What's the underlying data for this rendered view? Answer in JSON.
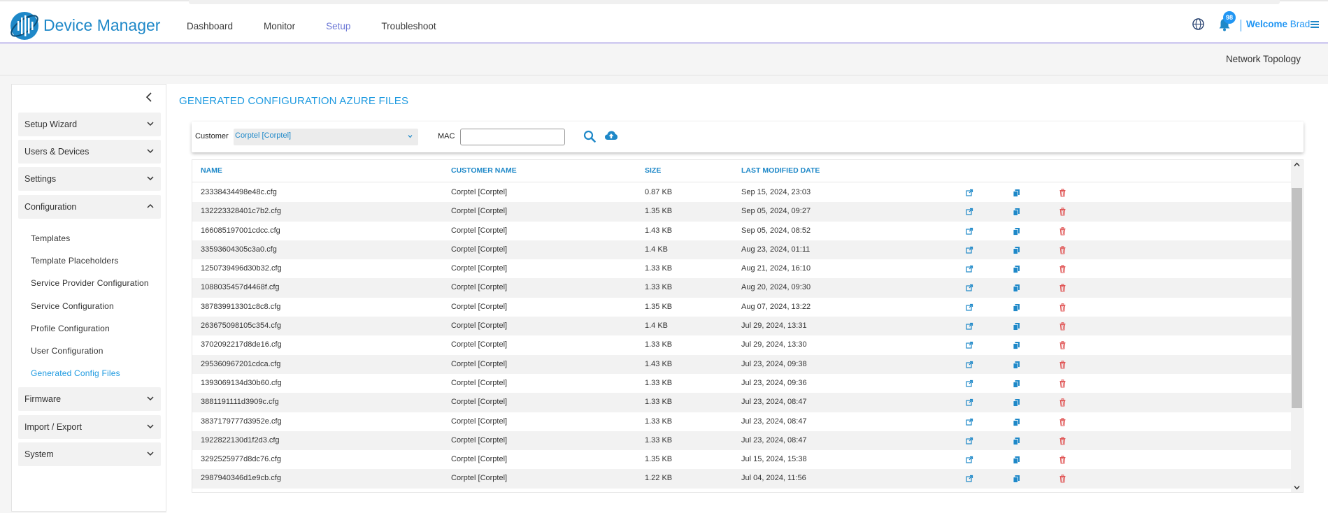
{
  "app": {
    "brand": "Device Manager",
    "nav": [
      "Dashboard",
      "Monitor",
      "Setup",
      "Troubleshoot"
    ],
    "active_nav": "Setup",
    "notification_count": "98",
    "welcome_prefix": "Welcome",
    "user_name": "Brad"
  },
  "subheader": {
    "network_topology": "Network Topology"
  },
  "sidebar": {
    "sections": [
      {
        "label": "Setup Wizard",
        "expanded": false
      },
      {
        "label": "Users & Devices",
        "expanded": false
      },
      {
        "label": "Settings",
        "expanded": false
      },
      {
        "label": "Configuration",
        "expanded": true
      },
      {
        "label": "Firmware",
        "expanded": false
      },
      {
        "label": "Import / Export",
        "expanded": false
      },
      {
        "label": "System",
        "expanded": false
      }
    ],
    "config_items": [
      "Templates",
      "Template Placeholders",
      "Service Provider Configuration",
      "Service Configuration",
      "Profile Configuration",
      "User Configuration",
      "Generated Config Files"
    ],
    "active_item": "Generated Config Files"
  },
  "main": {
    "title": "GENERATED CONFIGURATION AZURE FILES",
    "filters": {
      "customer_label": "Customer",
      "customer_value": "Corptel [Corptel]",
      "mac_label": "MAC",
      "mac_value": ""
    },
    "columns": [
      "NAME",
      "CUSTOMER NAME",
      "SIZE",
      "LAST MODIFIED DATE"
    ],
    "rows": [
      {
        "name": "23338434498e48c.cfg",
        "customer": "Corptel [Corptel]",
        "size": "0.87 KB",
        "modified": "Sep 15, 2024, 23:03"
      },
      {
        "name": "132223328401c7b2.cfg",
        "customer": "Corptel [Corptel]",
        "size": "1.35 KB",
        "modified": "Sep 05, 2024, 09:27"
      },
      {
        "name": "166085197001cdcc.cfg",
        "customer": "Corptel [Corptel]",
        "size": "1.43 KB",
        "modified": "Sep 05, 2024, 08:52"
      },
      {
        "name": "33593604305c3a0.cfg",
        "customer": "Corptel [Corptel]",
        "size": "1.4 KB",
        "modified": "Aug 23, 2024, 01:11"
      },
      {
        "name": "1250739496d30b32.cfg",
        "customer": "Corptel [Corptel]",
        "size": "1.33 KB",
        "modified": "Aug 21, 2024, 16:10"
      },
      {
        "name": "1088035457d4468f.cfg",
        "customer": "Corptel [Corptel]",
        "size": "1.33 KB",
        "modified": "Aug 20, 2024, 09:30"
      },
      {
        "name": "387839913301c8c8.cfg",
        "customer": "Corptel [Corptel]",
        "size": "1.35 KB",
        "modified": "Aug 07, 2024, 13:22"
      },
      {
        "name": "263675098105c354.cfg",
        "customer": "Corptel [Corptel]",
        "size": "1.4 KB",
        "modified": "Jul 29, 2024, 13:31"
      },
      {
        "name": "3702092217d8de16.cfg",
        "customer": "Corptel [Corptel]",
        "size": "1.33 KB",
        "modified": "Jul 29, 2024, 13:30"
      },
      {
        "name": "295360967201cdca.cfg",
        "customer": "Corptel [Corptel]",
        "size": "1.43 KB",
        "modified": "Jul 23, 2024, 09:38"
      },
      {
        "name": "1393069134d30b60.cfg",
        "customer": "Corptel [Corptel]",
        "size": "1.33 KB",
        "modified": "Jul 23, 2024, 09:36"
      },
      {
        "name": "3881191111d3909c.cfg",
        "customer": "Corptel [Corptel]",
        "size": "1.33 KB",
        "modified": "Jul 23, 2024, 08:47"
      },
      {
        "name": "3837179777d3952e.cfg",
        "customer": "Corptel [Corptel]",
        "size": "1.33 KB",
        "modified": "Jul 23, 2024, 08:47"
      },
      {
        "name": "1922822130d1f2d3.cfg",
        "customer": "Corptel [Corptel]",
        "size": "1.33 KB",
        "modified": "Jul 23, 2024, 08:47"
      },
      {
        "name": "3292525977d8dc76.cfg",
        "customer": "Corptel [Corptel]",
        "size": "1.35 KB",
        "modified": "Jul 15, 2024, 15:38"
      },
      {
        "name": "2987940346d1e9cb.cfg",
        "customer": "Corptel [Corptel]",
        "size": "1.22 KB",
        "modified": "Jul 04, 2024, 11:56"
      }
    ],
    "row_actions": [
      "open-external-icon",
      "copy-icon",
      "trash-icon"
    ]
  },
  "colors": {
    "accent": "#1e88c8",
    "active_nav": "#6c78d6",
    "delete": "#e05555",
    "row_alt": "#f2f2f2"
  }
}
